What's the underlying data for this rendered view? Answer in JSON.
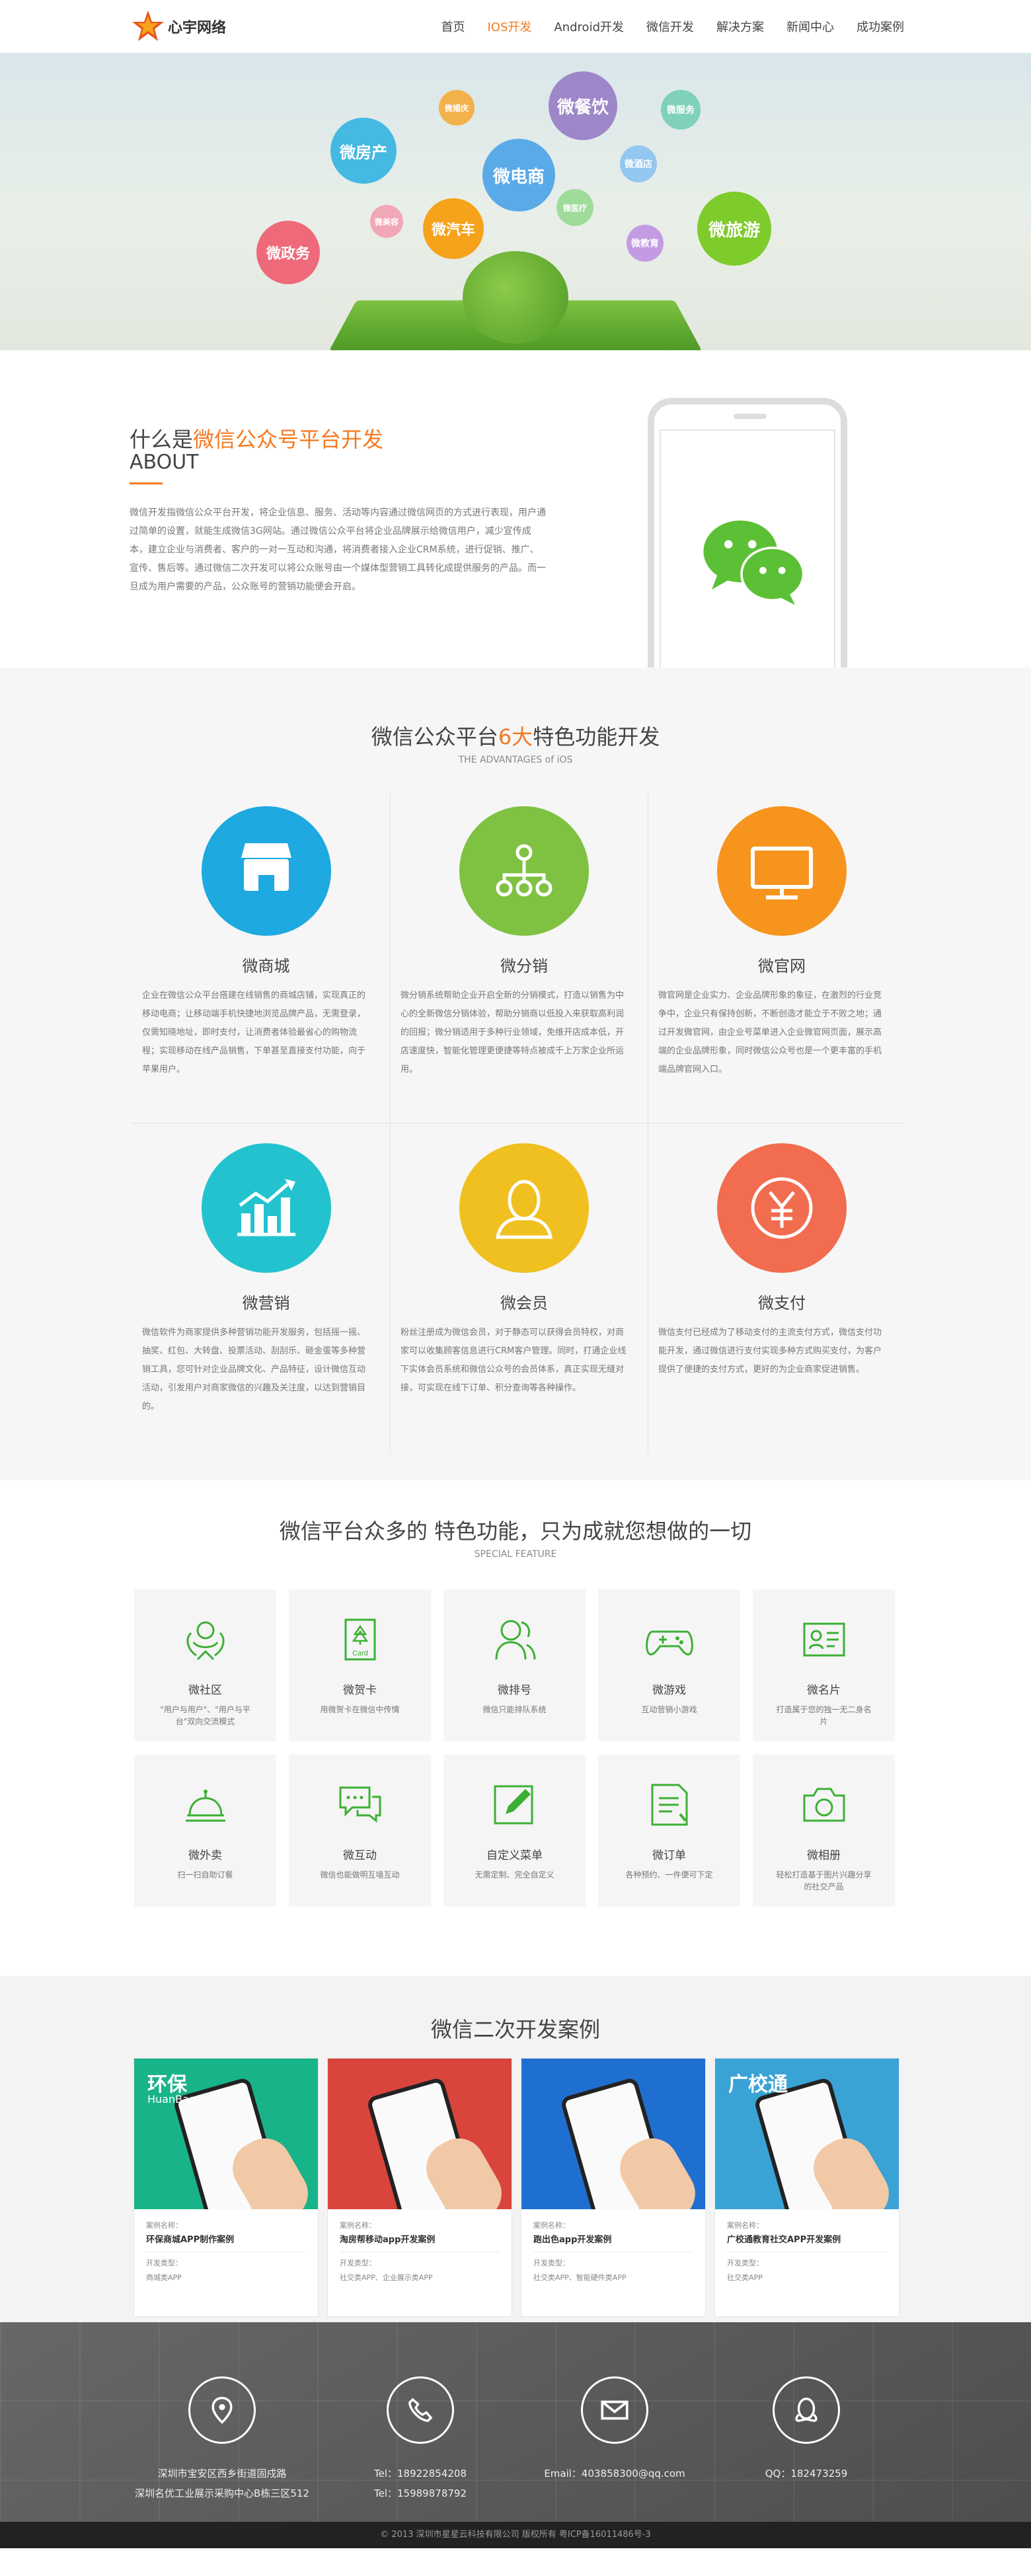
{
  "header": {
    "logo_text": "心宇网络",
    "nav": [
      "首页",
      "IOS开发",
      "Android开发",
      "微信开发",
      "解决方案",
      "新闻中心",
      "成功案例"
    ],
    "active_index": 1,
    "accent": "#f47920"
  },
  "hero": {
    "bubbles": [
      "微餐饮",
      "微房产",
      "微电商",
      "微旅游",
      "微汽车",
      "微政务",
      "微酒店",
      "微服务",
      "微教育",
      "微医疗",
      "微美容",
      "微婚庆"
    ]
  },
  "about": {
    "title_prefix": "什么是",
    "title_highlight": "微信公众号平台开发",
    "subtitle": "ABOUT",
    "text": "微信开发指微信公众平台开发，将企业信息、服务、活动等内容通过微信网页的方式进行表现，用户通过简单的设置，就能生成微信3G网站。通过微信公众平台将企业品牌展示给微信用户，减少宣传成本，建立企业与消费者、客户的一对一互动和沟通，将消费者接入企业CRM系统，进行促销、推广、宣传、售后等。通过微信二次开发可以将公众账号由一个媒体型营销工具转化成提供服务的产品。而一旦成为用户需要的产品，公众账号的营销功能便会开启。"
  },
  "advantages": {
    "title_prefix": "微信公众平台",
    "title_highlight": "6大",
    "title_suffix": "特色功能开发",
    "subtitle": "THE ADVANTAGES of iOS",
    "items": [
      {
        "name": "微商城",
        "color": "#1ea9e1",
        "icon": "shop-icon",
        "text": "企业在微信公众平台搭建在线销售的商城店铺，实现真正的移动电商；让移动端手机快捷地浏览品牌产品，无需登录，仅需知晓地址，即时支付，让消费者体验最省心的购物流程；实现移动在线产品销售，下单甚至直接支付功能，向于苹果用户。"
      },
      {
        "name": "微分销",
        "color": "#7fc242",
        "icon": "network-icon",
        "text": "微分销系统帮助企业开启全新的分销模式，打造以销售为中心的全新微信分销体验，帮助分销商以低投入来获取高利润的回报；微分销适用于多种行业领域，免维开店成本低，开店速度快，智能化管理更便捷等特点被成千上万家企业所运用。"
      },
      {
        "name": "微官网",
        "color": "#f7941d",
        "icon": "monitor-icon",
        "text": "微官网是企业实力、企业品牌形象的象征，在激烈的行业竞争中，企业只有保持创新，不断创造才能立于不败之地；通过开发微官网，由企业号菜单进入企业微官网页面，展示高端的企业品牌形象，同时微信公众号也是一个更丰富的手机端品牌官网入口。"
      },
      {
        "name": "微营销",
        "color": "#22c3cf",
        "icon": "chart-icon",
        "text": "微信软件为商家提供多种营销功能开发服务，包括摇一摇、抽奖、红包、大转盘、投票活动、刮刮乐、砸金蛋等多种营销工具，您可针对企业品牌文化、产品特征，设计微信互动活动，引发用户对商家微信的兴趣及关注度，以达到营销目的。"
      },
      {
        "name": "微会员",
        "color": "#f0c020",
        "icon": "user-icon",
        "text": "粉丝注册成为微信会员，对于静态可以获得会员特权，对商家可以收集顾客信息进行CRM客户管理。同时，打通企业线下实体会员系统和微信公众号的会员体系，真正实现无缝对接，可实现在线下订单、积分查询等各种操作。"
      },
      {
        "name": "微支付",
        "color": "#f26c4f",
        "icon": "yen-icon",
        "text": "微信支付已经成为了移动支付的主流支付方式，微信支付功能开发，通过微信进行支付实现多种方式购买支付，为客户提供了便捷的支付方式，更好的为企业商家促进销售。"
      }
    ]
  },
  "features": {
    "title": "微信平台众多的 特色功能，只为成就您想做的一切",
    "subtitle": "SPECIAL FEATURE",
    "items": [
      {
        "name": "微社区",
        "icon": "community-icon",
        "desc": "\"用户与用户\"、\"用户与平台\"双向交流模式"
      },
      {
        "name": "微贺卡",
        "icon": "card-icon",
        "desc": "用微贺卡在微信中传情"
      },
      {
        "name": "微排号",
        "icon": "queue-icon",
        "desc": "微信只能排队系统"
      },
      {
        "name": "微游戏",
        "icon": "gamepad-icon",
        "desc": "互动营销小游戏"
      },
      {
        "name": "微名片",
        "icon": "namecard-icon",
        "desc": "打造属于您的独一无二身名片"
      },
      {
        "name": "微外卖",
        "icon": "dish-icon",
        "desc": "扫一扫自助订餐"
      },
      {
        "name": "微互动",
        "icon": "chat-icon",
        "desc": "微信也能做明互墙互动"
      },
      {
        "name": "自定义菜单",
        "icon": "edit-icon",
        "desc": "无需定制、完全自定义"
      },
      {
        "name": "微订单",
        "icon": "order-icon",
        "desc": "各种预约、一件便可下定"
      },
      {
        "name": "微相册",
        "icon": "camera-icon",
        "desc": "轻松打造基于图片兴趣分享的社交产品"
      }
    ]
  },
  "cases": {
    "title": "微信二次开发案例",
    "items": [
      {
        "label": "案例名称：",
        "title": "环保商城APP制作案例",
        "type_label": "开发类型：",
        "type": "商城类APP",
        "bg": "#19b389",
        "img_text": "环保",
        "img_sub": "HuanBao"
      },
      {
        "label": "案例名称：",
        "title": "淘房帮移动app开发案例",
        "type_label": "开发类型：",
        "type": "社交类APP、企业展示类APP",
        "bg": "#d9453d",
        "img_text": "",
        "img_sub": ""
      },
      {
        "label": "案例名称：",
        "title": "跑出色app开发案例",
        "type_label": "开发类型：",
        "type": "社交类APP、智能硬件类APP",
        "bg": "#1f6fd0",
        "img_text": "",
        "img_sub": ""
      },
      {
        "label": "案例名称：",
        "title": "广校通教育社交APP开发案例",
        "type_label": "开发类型：",
        "type": "社交类APP",
        "bg": "#3aa3d6",
        "img_text": "广校通",
        "img_sub": ""
      }
    ]
  },
  "footer": {
    "address": [
      "深圳市宝安区西乡街道固戍路",
      "深圳名优工业展示采购中心B栋三区512"
    ],
    "tel": [
      "Tel：18922854208",
      "Tel：15989878792"
    ],
    "email": "Email：403858300@qq.com",
    "qq": "QQ：182473259",
    "copyright": "© 2013 深圳市星星云科技有限公司 版权所有 粤ICP备16011486号-3"
  }
}
